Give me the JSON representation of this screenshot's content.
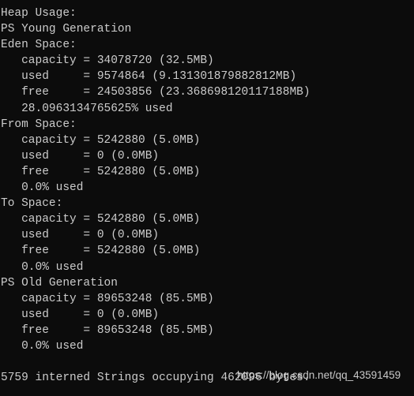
{
  "terminal": {
    "background_color": "#0c0c0c",
    "text_color": "#cccccc",
    "lines": [
      "Heap Usage:",
      "PS Young Generation",
      "Eden Space:",
      "   capacity = 34078720 (32.5MB)",
      "   used     = 9574864 (9.131301879882812MB)",
      "   free     = 24503856 (23.368698120117188MB)",
      "   28.0963134765625% used",
      "From Space:",
      "   capacity = 5242880 (5.0MB)",
      "   used     = 0 (0.0MB)",
      "   free     = 5242880 (5.0MB)",
      "   0.0% used",
      "To Space:",
      "   capacity = 5242880 (5.0MB)",
      "   used     = 0 (0.0MB)",
      "   free     = 5242880 (5.0MB)",
      "   0.0% used",
      "PS Old Generation",
      "   capacity = 89653248 (85.5MB)",
      "   used     = 0 (0.0MB)",
      "   free     = 89653248 (85.5MB)",
      "   0.0% used",
      "",
      "5759 interned Strings occupying 462096 bytes."
    ]
  },
  "watermark": {
    "text": "https://blog.csdn.net/qq_43591459",
    "color": "#d9d9d9"
  }
}
